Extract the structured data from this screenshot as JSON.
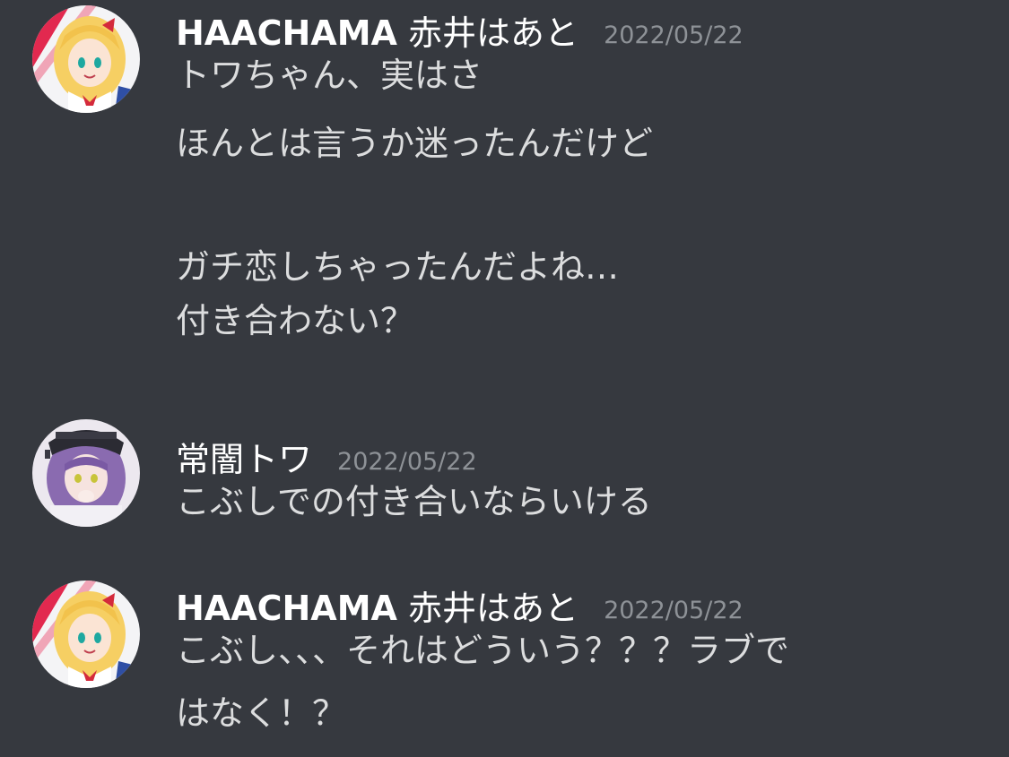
{
  "messages": [
    {
      "author_latin": "HAACHAMA",
      "author_jp": "赤井はあと",
      "timestamp": "2022/05/22",
      "lines": [
        "トワちゃん、実はさ",
        "ほんとは言うか迷ったんだけど",
        "ガチ恋しちゃったんだよね…",
        "付き合わない？"
      ],
      "avatar_icon": "haachama-avatar"
    },
    {
      "author_latin": "",
      "author_jp": "常闇トワ",
      "timestamp": "2022/05/22",
      "lines": [
        "こぶしでの付き合いならいける"
      ],
      "avatar_icon": "towa-avatar"
    },
    {
      "author_latin": "HAACHAMA",
      "author_jp": "赤井はあと",
      "timestamp": "2022/05/22",
      "lines": [
        "こぶし、、、それはどういう？？？ラブで",
        "はなく！？"
      ],
      "avatar_icon": "haachama-avatar"
    }
  ],
  "colors": {
    "background": "#36393f",
    "author": "#ffffff",
    "text": "#dcddde",
    "timestamp": "#8e9297"
  }
}
